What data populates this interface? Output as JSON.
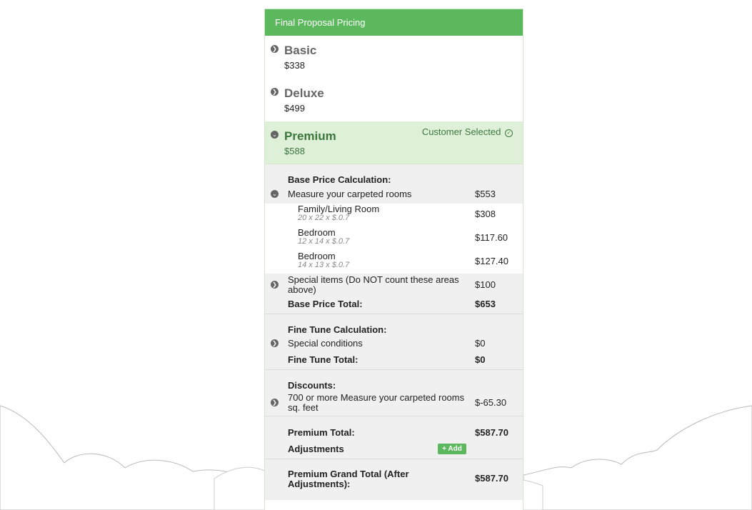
{
  "header": {
    "title": "Final Proposal Pricing"
  },
  "packages": [
    {
      "name": "Basic",
      "price": "$338"
    },
    {
      "name": "Deluxe",
      "price": "$499"
    },
    {
      "name": "Premium",
      "price": "$588",
      "selected_label": "Customer Selected"
    }
  ],
  "base": {
    "heading": "Base Price Calculation:",
    "measure_label": "Measure your carpeted rooms",
    "measure_amount": "$553",
    "rooms": [
      {
        "name": "Family/Living Room",
        "formula": "20 x 22 x $.0.7",
        "amount": "$308"
      },
      {
        "name": "Bedroom",
        "formula": "12 x 14 x $.0.7",
        "amount": "$117.60"
      },
      {
        "name": "Bedroom",
        "formula": "14 x 13 x $.0.7",
        "amount": "$127.40"
      }
    ],
    "special_label_1": "Special items (Do NOT count these areas",
    "special_label_2": "above)",
    "special_amount": "$100",
    "total_label": "Base Price Total:",
    "total_amount": "$653"
  },
  "fine_tune": {
    "heading": "Fine Tune Calculation:",
    "conditions_label": "Special conditions",
    "conditions_amount": "$0",
    "total_label": "Fine Tune Total:",
    "total_amount": "$0"
  },
  "discounts": {
    "heading": "Discounts:",
    "item_label_1": "700 or more Measure your carpeted rooms",
    "item_label_2": "sq. feet",
    "item_amount": "$-65.30"
  },
  "totals": {
    "premium_label": "Premium Total:",
    "premium_amount": "$587.70",
    "adjustments_label": "Adjustments",
    "add_button": "+ Add",
    "grand_label_1": "Premium Grand Total (After",
    "grand_label_2": "Adjustments):",
    "grand_amount": "$587.70"
  },
  "colors": {
    "accent": "#5cb85c",
    "selected_bg": "#dff0d8",
    "selected_text": "#3c763d"
  }
}
